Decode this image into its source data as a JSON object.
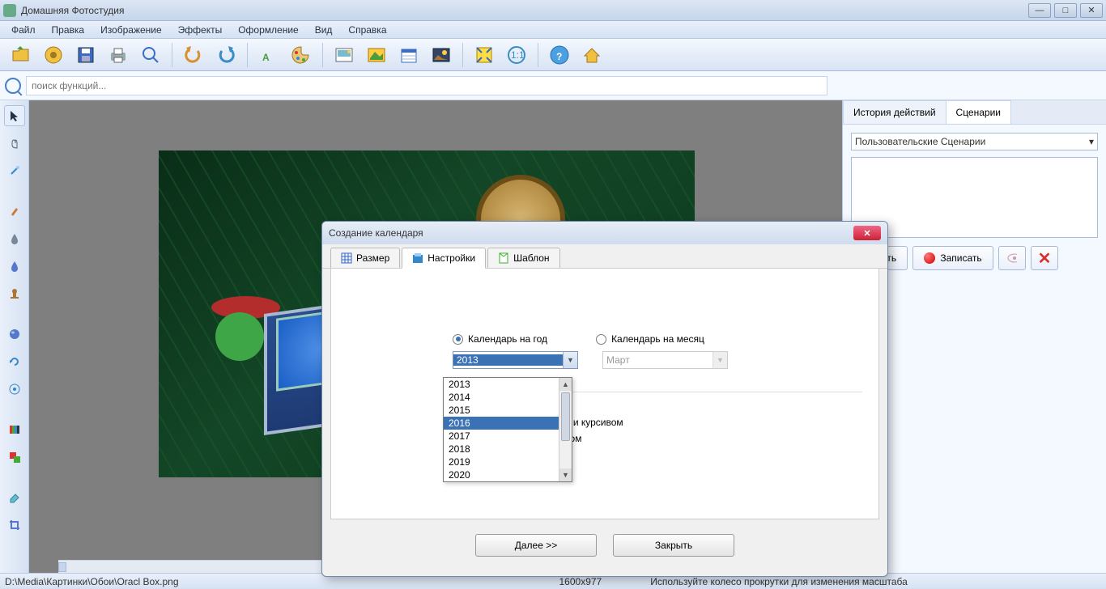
{
  "window": {
    "title": "Домашняя Фотостудия"
  },
  "menu": [
    "Файл",
    "Правка",
    "Изображение",
    "Эффекты",
    "Оформление",
    "Вид",
    "Справка"
  ],
  "search": {
    "placeholder": "поиск функций..."
  },
  "right_panel": {
    "tabs": [
      "История действий",
      "Сценарии"
    ],
    "active_tab": 1,
    "select_label": "Пользовательские Сценарии",
    "btn_run": "пустить",
    "btn_record": "Записать"
  },
  "statusbar": {
    "path": "D:\\Media\\Картинки\\Обои\\Oracl Box.png",
    "dims": "1600x977",
    "hint": "Используйте колесо прокрутки для изменения масштаба"
  },
  "dialog": {
    "title": "Создание календаря",
    "tabs": [
      "Размер",
      "Настройки",
      "Шаблон"
    ],
    "active_tab": 1,
    "radio_year": "Календарь на год",
    "radio_month": "Календарь на месяц",
    "year_value": "2013",
    "month_value": "Март",
    "check1_partial": "цев жирным шрифтом и курсивом",
    "check2_partial": "ндаря жирным шрифтом",
    "btn_next": "Далее >>",
    "btn_close": "Закрыть"
  },
  "year_dropdown": {
    "options": [
      "2013",
      "2014",
      "2015",
      "2016",
      "2017",
      "2018",
      "2019",
      "2020"
    ],
    "highlighted": "2016"
  }
}
